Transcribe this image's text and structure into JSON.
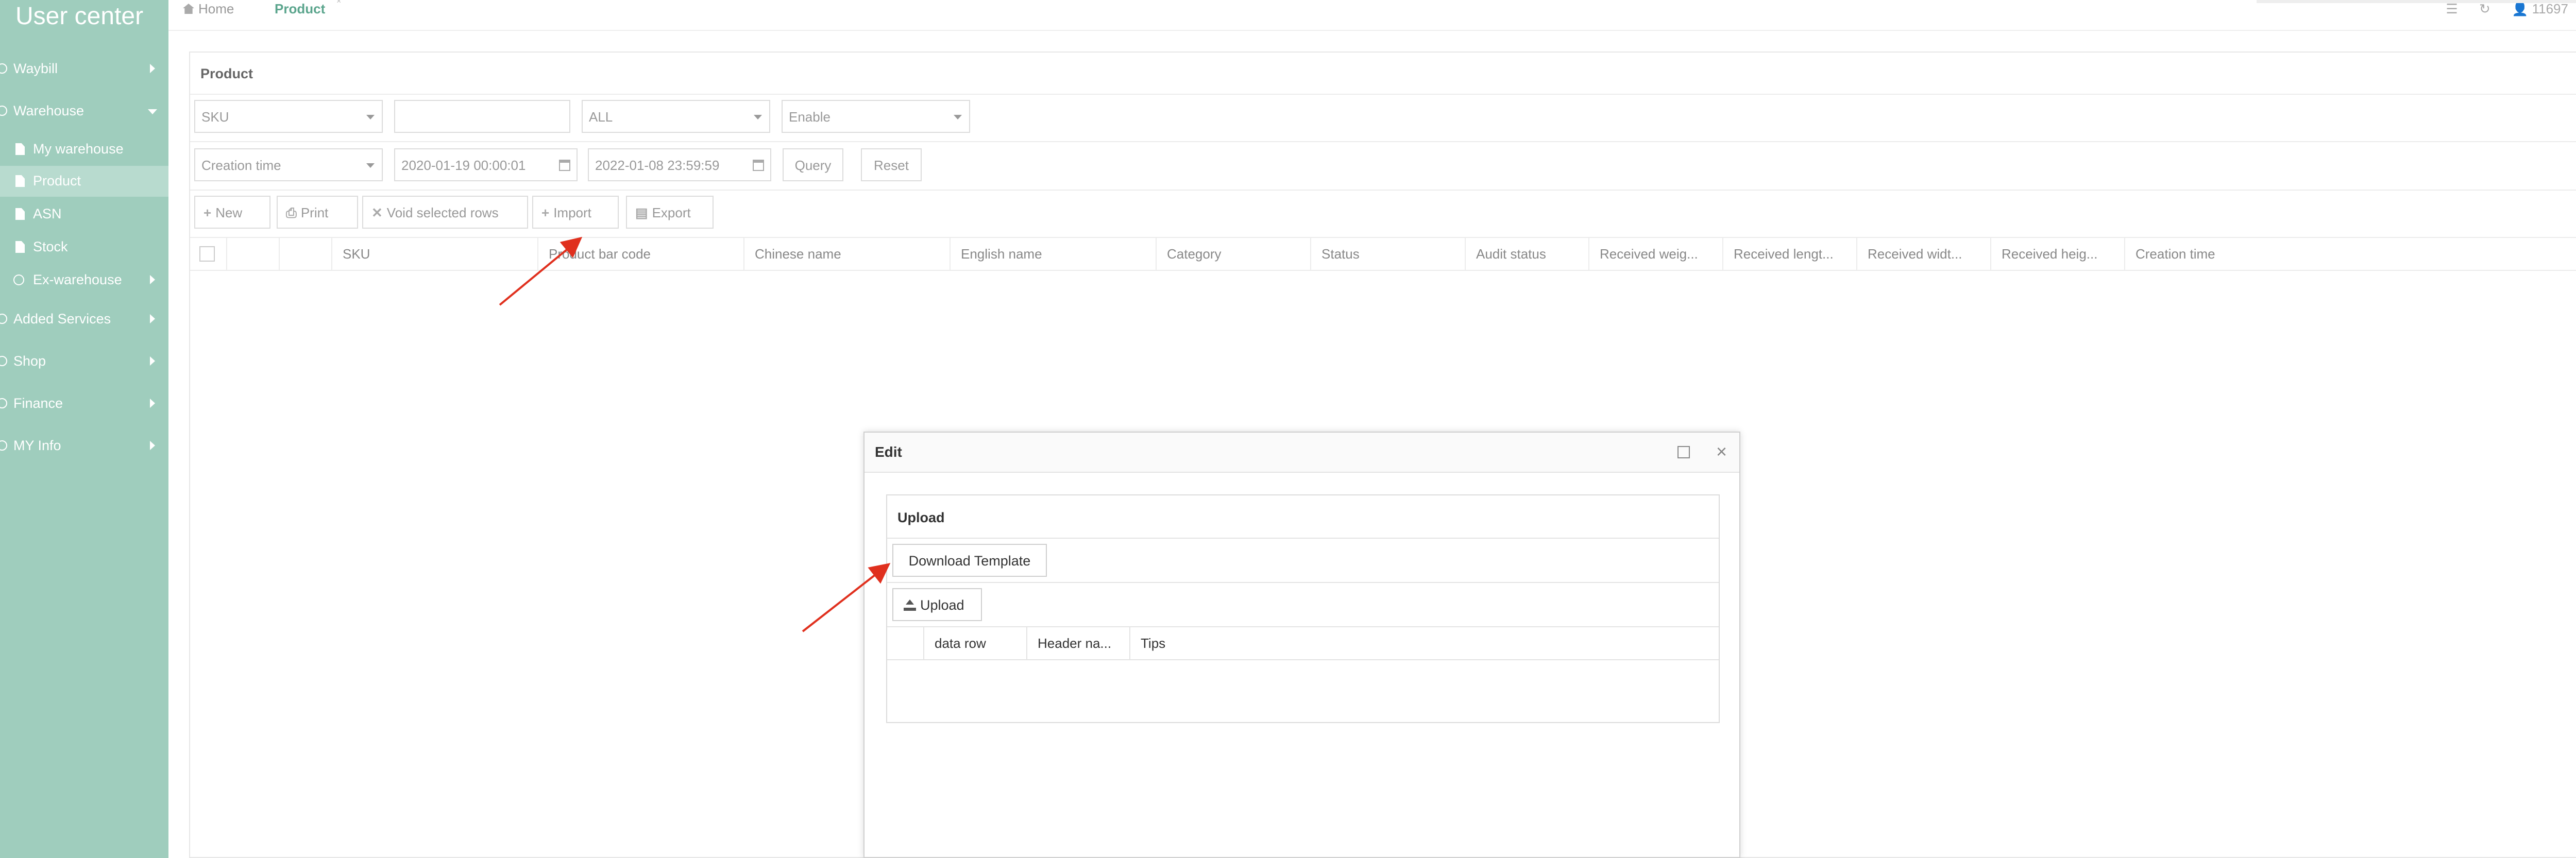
{
  "sidebar": {
    "brand": "User center",
    "menu": [
      {
        "label": "Waybill"
      },
      {
        "label": "Warehouse"
      },
      {
        "label": "Added Services"
      },
      {
        "label": "Shop"
      },
      {
        "label": "Finance"
      },
      {
        "label": "MY Info"
      }
    ],
    "warehouse_items": [
      {
        "label": "My warehouse"
      },
      {
        "label": "Product"
      },
      {
        "label": "ASN"
      },
      {
        "label": "Stock"
      },
      {
        "label": "Ex-warehouse"
      }
    ]
  },
  "topbar": {
    "home_tab": "Home",
    "active_tab": "Product",
    "user_id": "11697"
  },
  "panel": {
    "title": "Product",
    "filters": {
      "field_select": "SKU",
      "keyword_value": "",
      "type_select": "ALL",
      "status_select": "Enable",
      "date_field_select": "Creation time",
      "date_from": "2020-01-19 00:00:01",
      "date_to": "2022-01-08 23:59:59",
      "query_label": "Query",
      "reset_label": "Reset"
    },
    "toolbar": {
      "new_label": "New",
      "print_label": "Print",
      "void_label": "Void selected rows",
      "import_label": "Import",
      "export_label": "Export"
    },
    "columns": [
      "SKU",
      "Product bar code",
      "Chinese name",
      "English name",
      "Category",
      "Status",
      "Audit status",
      "Received weig...",
      "Received lengt...",
      "Received widt...",
      "Received heig...",
      "Creation time"
    ]
  },
  "dialog": {
    "title": "Edit",
    "upload_section_title": "Upload",
    "download_template_label": "Download Template",
    "upload_label": "Upload",
    "columns": [
      "data row",
      "Header na...",
      "Tips"
    ]
  },
  "colors": {
    "sidebar_bg": "#9fcdbd",
    "accent": "#5ba58d",
    "arrow": "#e0301e"
  }
}
